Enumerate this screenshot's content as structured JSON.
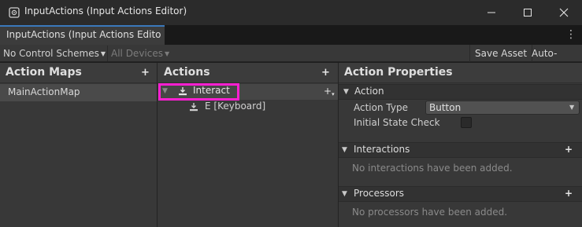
{
  "window": {
    "title": "InputActions (Input Actions Editor)",
    "controls": [
      "minimize-icon",
      "maximize-icon",
      "close-icon"
    ]
  },
  "tab": {
    "label": "InputActions (Input Actions Edito",
    "menu_icon": "kebab-menu-icon"
  },
  "toolbar": {
    "control_schemes": "No Control Schemes",
    "devices": "All Devices",
    "save_label": "Save Asset",
    "autosave_label": "Auto-Save"
  },
  "action_maps": {
    "title": "Action Maps",
    "items": [
      "MainActionMap"
    ]
  },
  "actions": {
    "title": "Actions",
    "items": [
      {
        "label": "Interact",
        "bindings": [
          "E [Keyboard]"
        ]
      }
    ]
  },
  "properties": {
    "title": "Action Properties",
    "action_section": "Action",
    "action_type_label": "Action Type",
    "action_type_value": "Button",
    "initial_state_label": "Initial State Check",
    "initial_state_checked": false,
    "interactions_title": "Interactions",
    "interactions_empty": "No interactions have been added.",
    "processors_title": "Processors",
    "processors_empty": "No processors have been added."
  },
  "colors": {
    "highlight": "#ff1fd2",
    "tab_accent": "#3a79bb",
    "panel_bg": "#383838"
  }
}
